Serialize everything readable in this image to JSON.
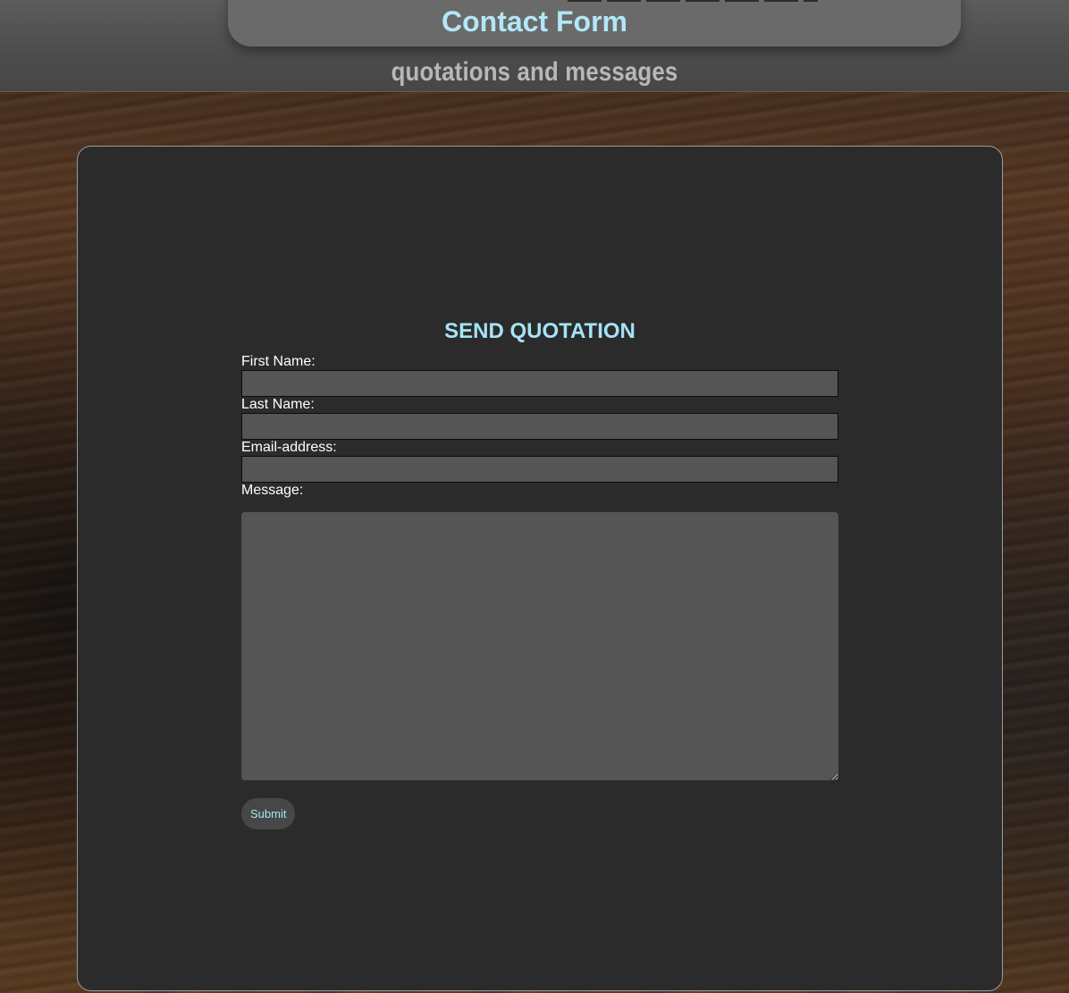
{
  "header": {
    "title": "Contact Form",
    "subtitle": "quotations and messages"
  },
  "form": {
    "title": "SEND QUOTATION",
    "first_name": {
      "label": "First Name:",
      "value": ""
    },
    "last_name": {
      "label": "Last Name:",
      "value": ""
    },
    "email": {
      "label": "Email-address:",
      "value": ""
    },
    "message": {
      "label": "Message:",
      "value": ""
    },
    "submit_label": "Submit"
  },
  "colors": {
    "accent": "#a6e3f6",
    "panel": "#2b2b2b",
    "input": "#555555"
  }
}
